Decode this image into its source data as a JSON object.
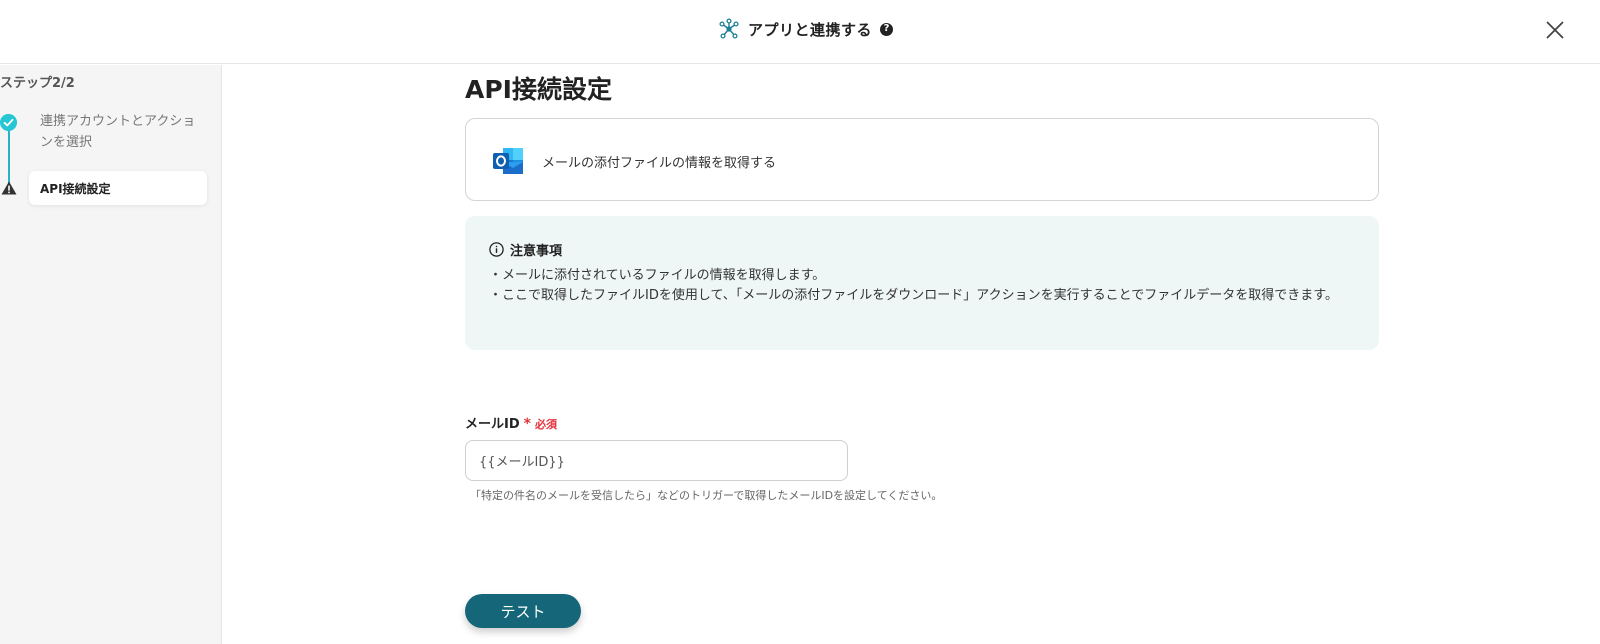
{
  "header": {
    "title": "アプリと連携する",
    "help_glyph": "?",
    "app_icon": "network-hub-icon",
    "close_icon": "close-icon"
  },
  "sidebar": {
    "step_label": "ステップ2/2",
    "steps": [
      {
        "label": "連携アカウントとアクションを選択",
        "status": "done",
        "icon": "check-icon"
      },
      {
        "label": "API接続設定",
        "status": "current-warning",
        "icon": "warning-icon"
      }
    ]
  },
  "main": {
    "title": "API接続設定",
    "action": {
      "icon": "outlook-icon",
      "text": "メールの添付ファイルの情報を取得する"
    },
    "notice": {
      "icon": "info-icon",
      "title": "注意事項",
      "lines": [
        "・メールに添付されているファイルの情報を取得します。",
        "・ここで取得したファイルIDを使用して、「メールの添付ファイルをダウンロード」アクションを実行することでファイルデータを取得できます。"
      ]
    },
    "field": {
      "label": "メールID",
      "required_mark": "*",
      "required_text": "必須",
      "value": "{{メールID}}",
      "help": "「特定の件名のメールを受信したら」などのトリガーで取得したメールIDを設定してください。"
    },
    "test_button": "テスト"
  },
  "colors": {
    "accent": "#156679",
    "step_done": "#27c6d4",
    "required": "#e5333b",
    "notice_bg": "#eff7f6"
  }
}
